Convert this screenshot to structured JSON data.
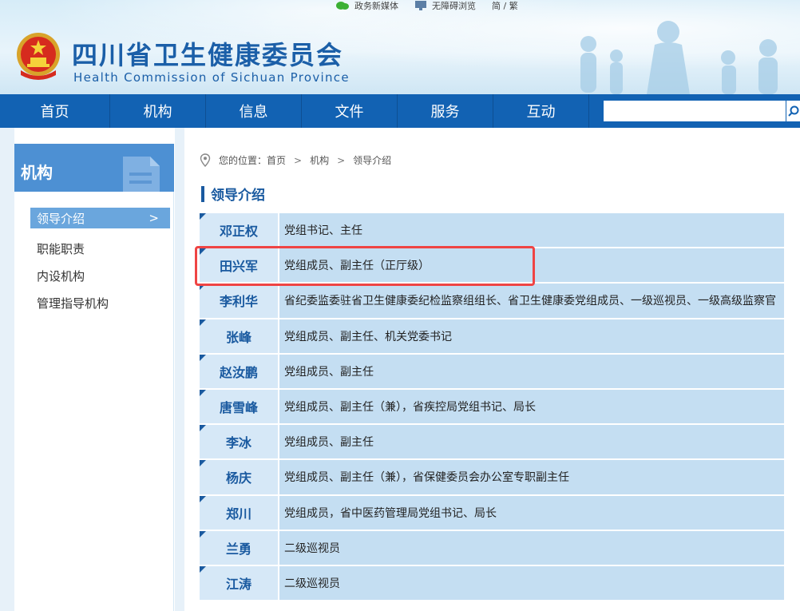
{
  "topbar": {
    "media_label": "政务新媒体",
    "accessible_label": "无障碍浏览",
    "lang_label": "简 / 繁"
  },
  "site": {
    "title_cn": "四川省卫生健康委员会",
    "title_en": "Health Commission of Sichuan Province"
  },
  "nav": {
    "items": [
      {
        "label": "首页"
      },
      {
        "label": "机构"
      },
      {
        "label": "信息"
      },
      {
        "label": "文件"
      },
      {
        "label": "服务"
      },
      {
        "label": "互动"
      }
    ],
    "search_value": ""
  },
  "sidebar": {
    "title": "机构",
    "items": [
      {
        "label": "领导介绍",
        "arrow": ">",
        "active": true
      },
      {
        "label": "职能职责"
      },
      {
        "label": "内设机构"
      },
      {
        "label": "管理指导机构"
      }
    ]
  },
  "breadcrumb": {
    "prefix": "您的位置：",
    "items": [
      "首页",
      "机构",
      "领导介绍"
    ],
    "separator": ">"
  },
  "section": {
    "title": "领导介绍"
  },
  "leaders": [
    {
      "name": "邓正权",
      "title": "党组书记、主任"
    },
    {
      "name": "田兴军",
      "title": "党组成员、副主任（正厅级）"
    },
    {
      "name": "李利华",
      "title": "省纪委监委驻省卫生健康委纪检监察组组长、省卫生健康委党组成员、一级巡视员、一级高级监察官"
    },
    {
      "name": "张峰",
      "title": "党组成员、副主任、机关党委书记"
    },
    {
      "name": "赵汝鹏",
      "title": "党组成员、副主任"
    },
    {
      "name": "唐雪峰",
      "title": "党组成员、副主任（兼），省疾控局党组书记、局长"
    },
    {
      "name": "李冰",
      "title": "党组成员、副主任"
    },
    {
      "name": "杨庆",
      "title": "党组成员、副主任（兼），省保健委员会办公室专职副主任"
    },
    {
      "name": "郑川",
      "title": "党组成员，省中医药管理局党组书记、局长"
    },
    {
      "name": "兰勇",
      "title": "二级巡视员"
    },
    {
      "name": "江涛",
      "title": "二级巡视员"
    }
  ],
  "colors": {
    "nav_bg": "#1262b3",
    "brand_blue": "#1b5fa8",
    "highlight": "#ef4444"
  }
}
